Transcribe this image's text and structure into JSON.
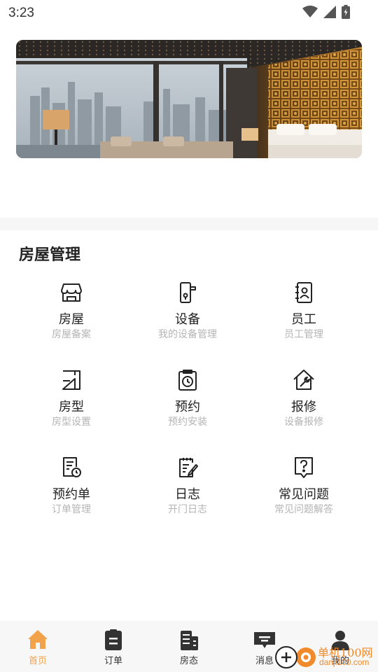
{
  "status_bar": {
    "time": "3:23"
  },
  "section": {
    "title": "房屋管理"
  },
  "grid": [
    {
      "label": "房屋",
      "sub": "房屋备案",
      "icon": "store-icon"
    },
    {
      "label": "设备",
      "sub": "我的设备管理",
      "icon": "door-lock-icon"
    },
    {
      "label": "员工",
      "sub": "员工管理",
      "icon": "contacts-book-icon"
    },
    {
      "label": "房型",
      "sub": "房型设置",
      "icon": "floor-plan-icon"
    },
    {
      "label": "预约",
      "sub": "预约安装",
      "icon": "clock-clipboard-icon"
    },
    {
      "label": "报修",
      "sub": "设备报修",
      "icon": "wrench-house-icon"
    },
    {
      "label": "预约单",
      "sub": "订单管理",
      "icon": "document-clock-icon"
    },
    {
      "label": "日志",
      "sub": "开门日志",
      "icon": "notepad-pen-icon"
    },
    {
      "label": "常见问题",
      "sub": "常见问题解答",
      "icon": "question-shield-icon"
    }
  ],
  "tabbar": [
    {
      "label": "首页",
      "icon": "home-icon",
      "active": true
    },
    {
      "label": "订单",
      "icon": "clipboard-icon",
      "active": false
    },
    {
      "label": "房态",
      "icon": "building-icon",
      "active": false
    },
    {
      "label": "消息",
      "icon": "message-icon",
      "active": false
    },
    {
      "label": "我的",
      "icon": "user-icon",
      "active": false
    }
  ],
  "watermark": {
    "text": "单机100网",
    "sub": "danji100.com"
  },
  "colors": {
    "accent": "#f2a24a",
    "subtext": "#b5b5b5",
    "tab_bg": "#f7f7f7"
  }
}
